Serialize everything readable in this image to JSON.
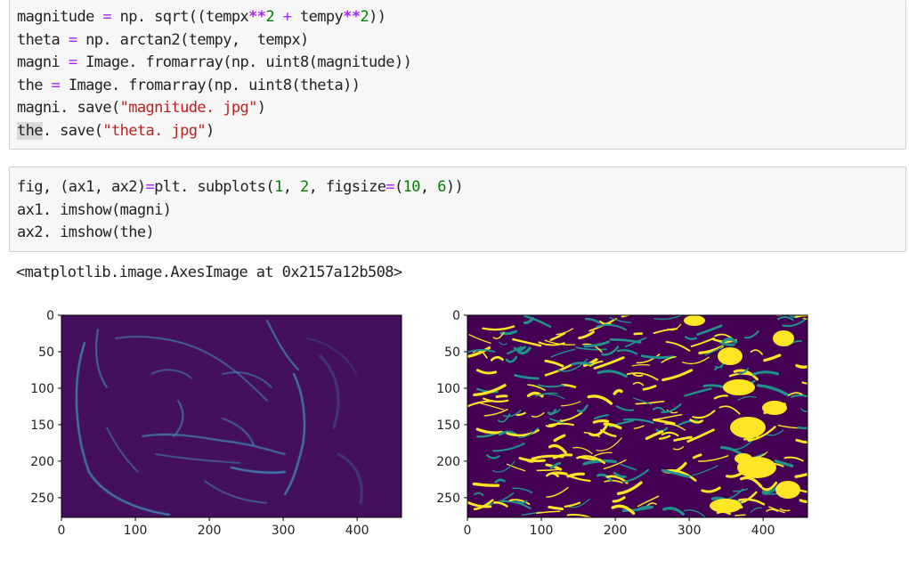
{
  "cell1": {
    "lines": [
      [
        {
          "t": "magnitude "
        },
        {
          "t": "=",
          "c": "op"
        },
        {
          "t": " np. sqrt((tempx"
        },
        {
          "t": "**",
          "c": "kw-op"
        },
        {
          "t": "2",
          "c": "num"
        },
        {
          "t": " "
        },
        {
          "t": "+",
          "c": "op"
        },
        {
          "t": " tempy"
        },
        {
          "t": "**",
          "c": "kw-op"
        },
        {
          "t": "2",
          "c": "num"
        },
        {
          "t": "))"
        }
      ],
      [
        {
          "t": "theta "
        },
        {
          "t": "=",
          "c": "op"
        },
        {
          "t": " np. arctan2(tempy,  tempx)"
        }
      ],
      [
        {
          "t": "magni "
        },
        {
          "t": "=",
          "c": "op"
        },
        {
          "t": " Image. fromarray(np. uint8(magnitude))"
        }
      ],
      [
        {
          "t": "the "
        },
        {
          "t": "=",
          "c": "op"
        },
        {
          "t": " Image. fromarray(np. uint8(theta))"
        }
      ],
      [
        {
          "t": "magni. save("
        },
        {
          "t": "\"magnitude. jpg\"",
          "c": "str"
        },
        {
          "t": ")"
        }
      ],
      [
        {
          "t": "the",
          "c": "hl"
        },
        {
          "t": ". save("
        },
        {
          "t": "\"theta. jpg\"",
          "c": "str"
        },
        {
          "t": ")"
        }
      ]
    ]
  },
  "cell2": {
    "lines": [
      [
        {
          "t": "fig, (ax1, ax2)"
        },
        {
          "t": "=",
          "c": "op"
        },
        {
          "t": "plt. subplots("
        },
        {
          "t": "1",
          "c": "num"
        },
        {
          "t": ", "
        },
        {
          "t": "2",
          "c": "num"
        },
        {
          "t": ", figsize"
        },
        {
          "t": "=",
          "c": "op"
        },
        {
          "t": "("
        },
        {
          "t": "10",
          "c": "num"
        },
        {
          "t": ", "
        },
        {
          "t": "6",
          "c": "num"
        },
        {
          "t": "))"
        }
      ],
      [
        {
          "t": "ax1. imshow(magni)"
        }
      ],
      [
        {
          "t": "ax2. imshow(the)"
        }
      ]
    ]
  },
  "output": {
    "text": "<matplotlib.image.AxesImage at 0x2157a12b508>"
  },
  "plots": {
    "ytick_labels": [
      "0",
      "50",
      "100",
      "150",
      "200",
      "250"
    ],
    "xtick_labels": [
      "0",
      "100",
      "200",
      "300",
      "400"
    ],
    "colors": {
      "magnitude_bg": "#440f5c",
      "magnitude_edges": "#3f7fb0",
      "theta_bg": "#440154",
      "theta_mid": "#21918c",
      "theta_high": "#fde725"
    }
  }
}
